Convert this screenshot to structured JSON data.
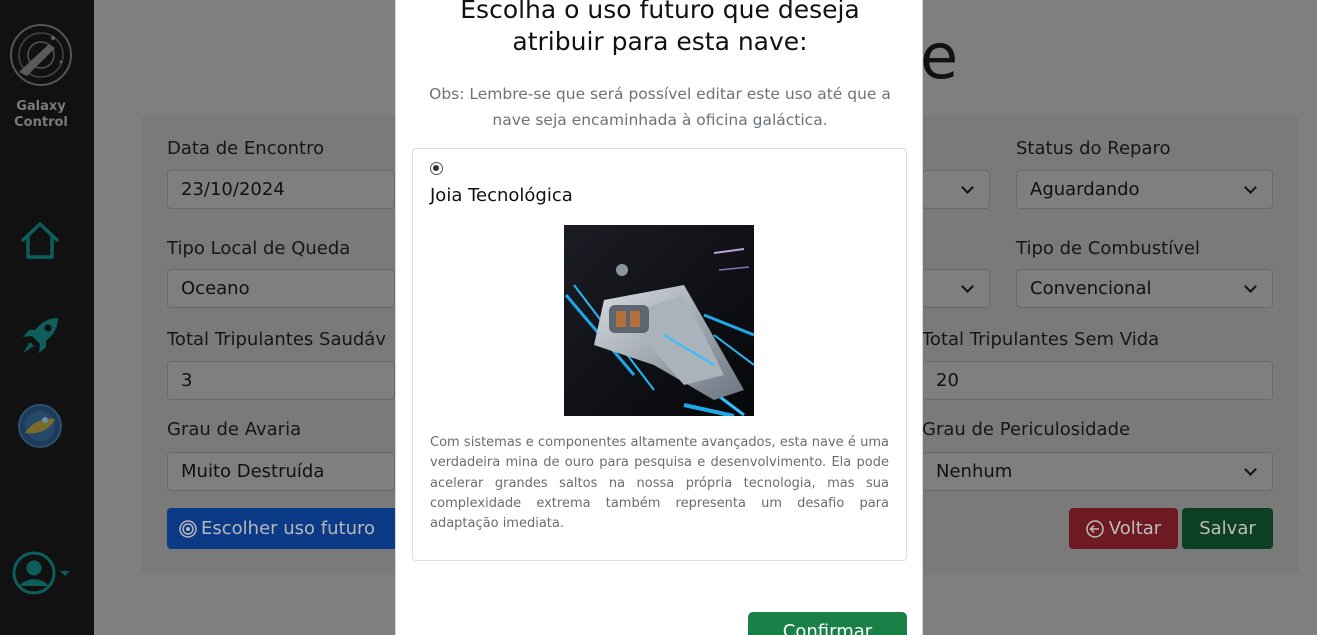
{
  "sidebar": {
    "brand_line1": "Galaxy",
    "brand_line2": "Control",
    "icons": [
      "logo-icon",
      "home-icon",
      "rocket-icon",
      "planet-icon",
      "user-icon"
    ]
  },
  "page": {
    "title_fragment": "e",
    "fields": {
      "data_encontro": {
        "label": "Data de Encontro",
        "value": "23/10/2024"
      },
      "status_reparo": {
        "label": "Status do Reparo",
        "value": "Aguardando"
      },
      "tipo_local": {
        "label": "Tipo Local de Queda",
        "value": "Oceano"
      },
      "tipo_combustivel": {
        "label": "Tipo de Combustível",
        "value": "Convencional"
      },
      "trip_saudaveis": {
        "label": "Total Tripulantes Saudáv",
        "value": "3"
      },
      "trip_sem_vida": {
        "label": "Total Tripulantes Sem Vida",
        "value": "20"
      },
      "grau_avaria": {
        "label": "Grau de Avaria",
        "value": "Muito Destruída"
      },
      "grau_periculosidade": {
        "label": "Grau de Periculosidade",
        "value": "Nenhum"
      }
    },
    "buttons": {
      "escolher": "Escolher uso futuro",
      "voltar": "Voltar",
      "salvar": "Salvar"
    }
  },
  "modal": {
    "title_line1": "Escolha o uso futuro que deseja",
    "title_line2": "atribuir para esta nave:",
    "note": "Obs: Lembre-se que será possível editar este uso até que a nave seja encaminhada à oficina galáctica.",
    "option": {
      "title": "Joia Tecnológica",
      "selected": true,
      "description": "Com sistemas e componentes altamente avançados, esta nave é uma verdadeira mina de ouro para pesquisa e desenvolvimento. Ela pode acelerar grandes saltos na nossa própria tecnologia, mas sua complexidade extrema também representa um desafio para adaptação imediata."
    },
    "confirm_label": "Confirmar"
  },
  "colors": {
    "overlay": "#7f7f7f",
    "sidebar": "#111111",
    "teal_icon": "#0f5e5e",
    "confirm": "#198048"
  }
}
